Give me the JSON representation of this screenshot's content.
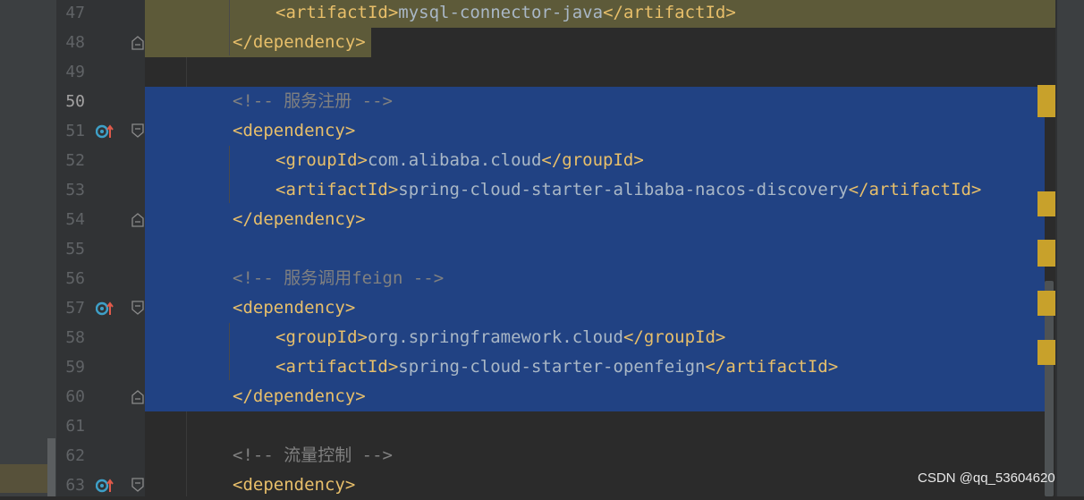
{
  "editor": {
    "lines": [
      {
        "num": "47",
        "kind": "tag",
        "indent": 2,
        "open": "<artifactId>",
        "text": "mysql-connector-java",
        "close": "</artifactId>",
        "hl": "yellow"
      },
      {
        "num": "48",
        "kind": "tag",
        "indent": 1,
        "open": "</dependency>",
        "text": "",
        "close": "",
        "hl": "yellow-partial",
        "fold": true
      },
      {
        "num": "49",
        "kind": "empty",
        "hl": "none"
      },
      {
        "num": "50",
        "kind": "comment",
        "indent": 1,
        "text": "<!-- 服务注册 -->",
        "hl": "blue",
        "active": true
      },
      {
        "num": "51",
        "kind": "tag",
        "indent": 1,
        "open": "<dependency>",
        "text": "",
        "close": "",
        "hl": "blue",
        "icon": true,
        "fold": true
      },
      {
        "num": "52",
        "kind": "tag",
        "indent": 2,
        "open": "<groupId>",
        "text": "com.alibaba.cloud",
        "close": "</groupId>",
        "hl": "blue"
      },
      {
        "num": "53",
        "kind": "tag",
        "indent": 2,
        "open": "<artifactId>",
        "text": "spring-cloud-starter-alibaba-nacos-discovery",
        "close": "</artifactId>",
        "hl": "blue"
      },
      {
        "num": "54",
        "kind": "tag",
        "indent": 1,
        "open": "</dependency>",
        "text": "",
        "close": "",
        "hl": "blue",
        "fold": true
      },
      {
        "num": "55",
        "kind": "empty",
        "hl": "blue"
      },
      {
        "num": "56",
        "kind": "comment",
        "indent": 1,
        "text": "<!-- 服务调用feign -->",
        "hl": "blue"
      },
      {
        "num": "57",
        "kind": "tag",
        "indent": 1,
        "open": "<dependency>",
        "text": "",
        "close": "",
        "hl": "blue",
        "icon": true,
        "fold": true
      },
      {
        "num": "58",
        "kind": "tag",
        "indent": 2,
        "open": "<groupId>",
        "text": "org.springframework.cloud",
        "close": "</groupId>",
        "hl": "blue"
      },
      {
        "num": "59",
        "kind": "tag",
        "indent": 2,
        "open": "<artifactId>",
        "text": "spring-cloud-starter-openfeign",
        "close": "</artifactId>",
        "hl": "blue"
      },
      {
        "num": "60",
        "kind": "tag",
        "indent": 1,
        "open": "</dependency>",
        "text": "",
        "close": "",
        "hl": "blue",
        "fold": true
      },
      {
        "num": "61",
        "kind": "empty",
        "hl": "none"
      },
      {
        "num": "62",
        "kind": "comment",
        "indent": 1,
        "text": "<!-- 流量控制 -->",
        "hl": "none"
      },
      {
        "num": "63",
        "kind": "tag",
        "indent": 1,
        "open": "<dependency>",
        "text": "",
        "close": "",
        "hl": "none",
        "icon": true,
        "fold": true
      }
    ]
  },
  "gutter_icon": "maven-override-icon",
  "fold_icon": "fold-marker-icon",
  "colors": {
    "tag": "#e8bf6a",
    "text": "#a9b7c6",
    "comment": "#808080",
    "selection": "#214283",
    "highlight": "#5d5a39"
  },
  "watermark": "CSDN @qq_53604620"
}
